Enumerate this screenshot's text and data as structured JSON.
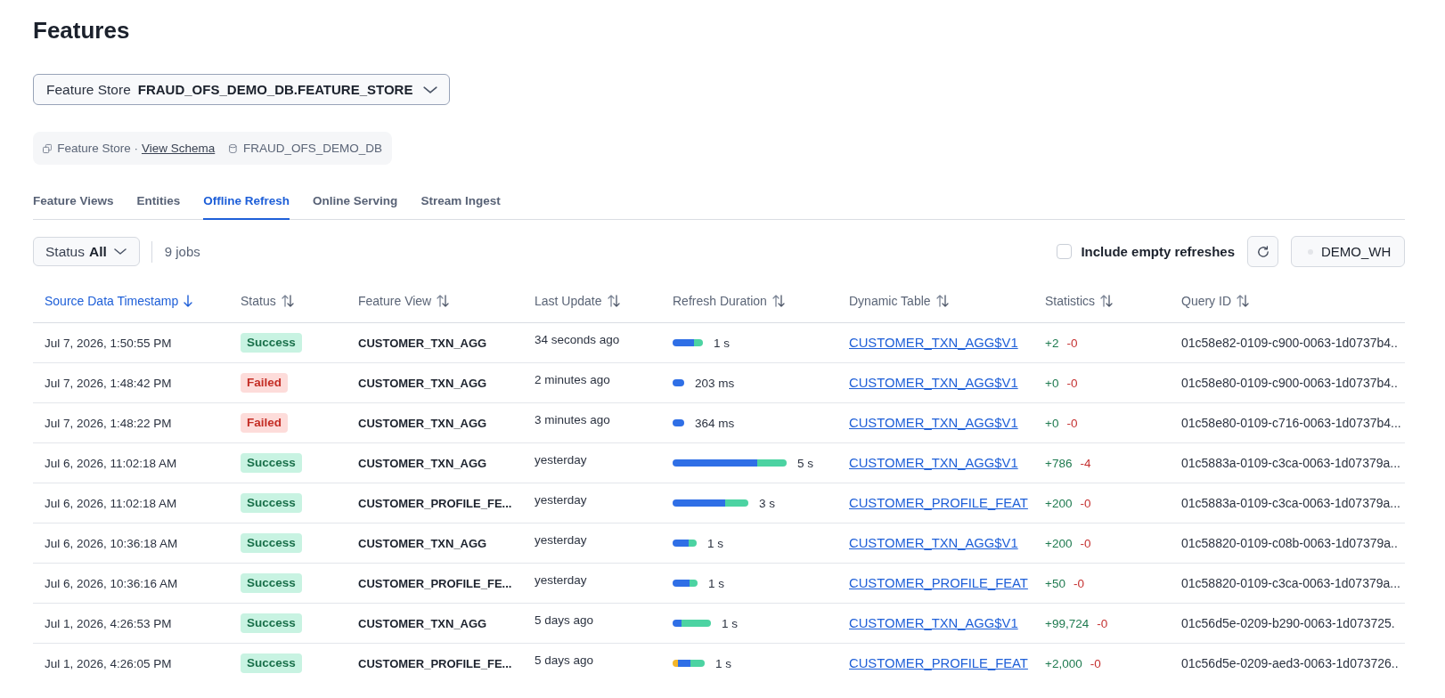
{
  "page": {
    "title": "Features"
  },
  "store_selector": {
    "label": "Feature Store",
    "value": "FRAUD_OFS_DEMO_DB.FEATURE_STORE"
  },
  "info_bar": {
    "label": "Feature Store ·",
    "link": "View Schema",
    "database": "FRAUD_OFS_DEMO_DB"
  },
  "tabs": [
    {
      "label": "Feature Views",
      "selected": false
    },
    {
      "label": "Entities",
      "selected": false
    },
    {
      "label": "Offline Refresh",
      "selected": true
    },
    {
      "label": "Online Serving",
      "selected": false
    },
    {
      "label": "Stream Ingest",
      "selected": false
    }
  ],
  "toolbar": {
    "status_filter": {
      "label": "Status",
      "value": "All"
    },
    "job_count": "9 jobs",
    "include_empty": {
      "label": "Include empty refreshes",
      "checked": false
    },
    "warehouse": "DEMO_WH"
  },
  "table": {
    "columns": [
      {
        "label": "Source Data Timestamp",
        "sorted": true
      },
      {
        "label": "Status",
        "sorted": false
      },
      {
        "label": "Feature View",
        "sorted": false
      },
      {
        "label": "Last Update",
        "sorted": false
      },
      {
        "label": "Refresh Duration",
        "sorted": false
      },
      {
        "label": "Dynamic Table",
        "sorted": false
      },
      {
        "label": "Statistics",
        "sorted": false
      },
      {
        "label": "Query ID",
        "sorted": false
      }
    ],
    "rows": [
      {
        "timestamp": "Jul 7, 2026, 1:50:55 PM",
        "status": {
          "label": "Success",
          "kind": "success"
        },
        "feature_view": "CUSTOMER_TXN_AGG",
        "last_update": "34 seconds ago",
        "duration": "1 s",
        "dynamic_table": "CUSTOMER_TXN_AGG$V1",
        "statistics": {
          "added": "+2",
          "removed": "-0"
        },
        "query_id": "01c58e82-0109-c900-0063-1d0737b4.."
      },
      {
        "timestamp": "Jul 7, 2026, 1:48:42 PM",
        "status": {
          "label": "Failed",
          "kind": "failed"
        },
        "feature_view": "CUSTOMER_TXN_AGG",
        "last_update": "2 minutes ago",
        "duration": "203 ms",
        "dynamic_table": "CUSTOMER_TXN_AGG$V1",
        "statistics": {
          "added": "+0",
          "removed": "-0"
        },
        "query_id": "01c58e80-0109-c900-0063-1d0737b4.."
      },
      {
        "timestamp": "Jul 7, 2026, 1:48:22 PM",
        "status": {
          "label": "Failed",
          "kind": "failed"
        },
        "feature_view": "CUSTOMER_TXN_AGG",
        "last_update": "3 minutes ago",
        "duration": "364 ms",
        "dynamic_table": "CUSTOMER_TXN_AGG$V1",
        "statistics": {
          "added": "+0",
          "removed": "-0"
        },
        "query_id": "01c58e80-0109-c716-0063-1d0737b4..."
      },
      {
        "timestamp": "Jul 6, 2026, 11:02:18 AM",
        "status": {
          "label": "Success",
          "kind": "success"
        },
        "feature_view": "CUSTOMER_TXN_AGG",
        "last_update": "yesterday",
        "duration": "5 s",
        "dynamic_table": "CUSTOMER_TXN_AGG$V1",
        "statistics": {
          "added": "+786",
          "removed": "-4"
        },
        "query_id": "01c5883a-0109-c3ca-0063-1d07379a..."
      },
      {
        "timestamp": "Jul 6, 2026, 11:02:18 AM",
        "status": {
          "label": "Success",
          "kind": "success"
        },
        "feature_view": "CUSTOMER_PROFILE_FE...",
        "last_update": "yesterday",
        "duration": "3 s",
        "dynamic_table": "CUSTOMER_PROFILE_FEAT",
        "statistics": {
          "added": "+200",
          "removed": "-0"
        },
        "query_id": "01c5883a-0109-c3ca-0063-1d07379a..."
      },
      {
        "timestamp": "Jul 6, 2026, 10:36:18 AM",
        "status": {
          "label": "Success",
          "kind": "success"
        },
        "feature_view": "CUSTOMER_TXN_AGG",
        "last_update": "yesterday",
        "duration": "1 s",
        "dynamic_table": "CUSTOMER_TXN_AGG$V1",
        "statistics": {
          "added": "+200",
          "removed": "-0"
        },
        "query_id": "01c58820-0109-c08b-0063-1d07379a.."
      },
      {
        "timestamp": "Jul 6, 2026, 10:36:16 AM",
        "status": {
          "label": "Success",
          "kind": "success"
        },
        "feature_view": "CUSTOMER_PROFILE_FE...",
        "last_update": "yesterday",
        "duration": "1 s",
        "dynamic_table": "CUSTOMER_PROFILE_FEAT",
        "statistics": {
          "added": "+50",
          "removed": "-0"
        },
        "query_id": "01c58820-0109-c3ca-0063-1d07379a..."
      },
      {
        "timestamp": "Jul 1, 2026, 4:26:53 PM",
        "status": {
          "label": "Success",
          "kind": "success"
        },
        "feature_view": "CUSTOMER_TXN_AGG",
        "last_update": "5 days ago",
        "duration": "1 s",
        "dynamic_table": "CUSTOMER_TXN_AGG$V1",
        "statistics": {
          "added": "+99,724",
          "removed": "-0"
        },
        "query_id": "01c56d5e-0209-b290-0063-1d073725."
      },
      {
        "timestamp": "Jul 1, 2026, 4:26:05 PM",
        "status": {
          "label": "Success",
          "kind": "success"
        },
        "feature_view": "CUSTOMER_PROFILE_FE...",
        "last_update": "5 days ago",
        "duration": "1 s",
        "dynamic_table": "CUSTOMER_PROFILE_FEAT",
        "statistics": {
          "added": "+2,000",
          "removed": "-0"
        },
        "query_id": "01c56d5e-0209-aed3-0063-1d073726.."
      }
    ]
  }
}
